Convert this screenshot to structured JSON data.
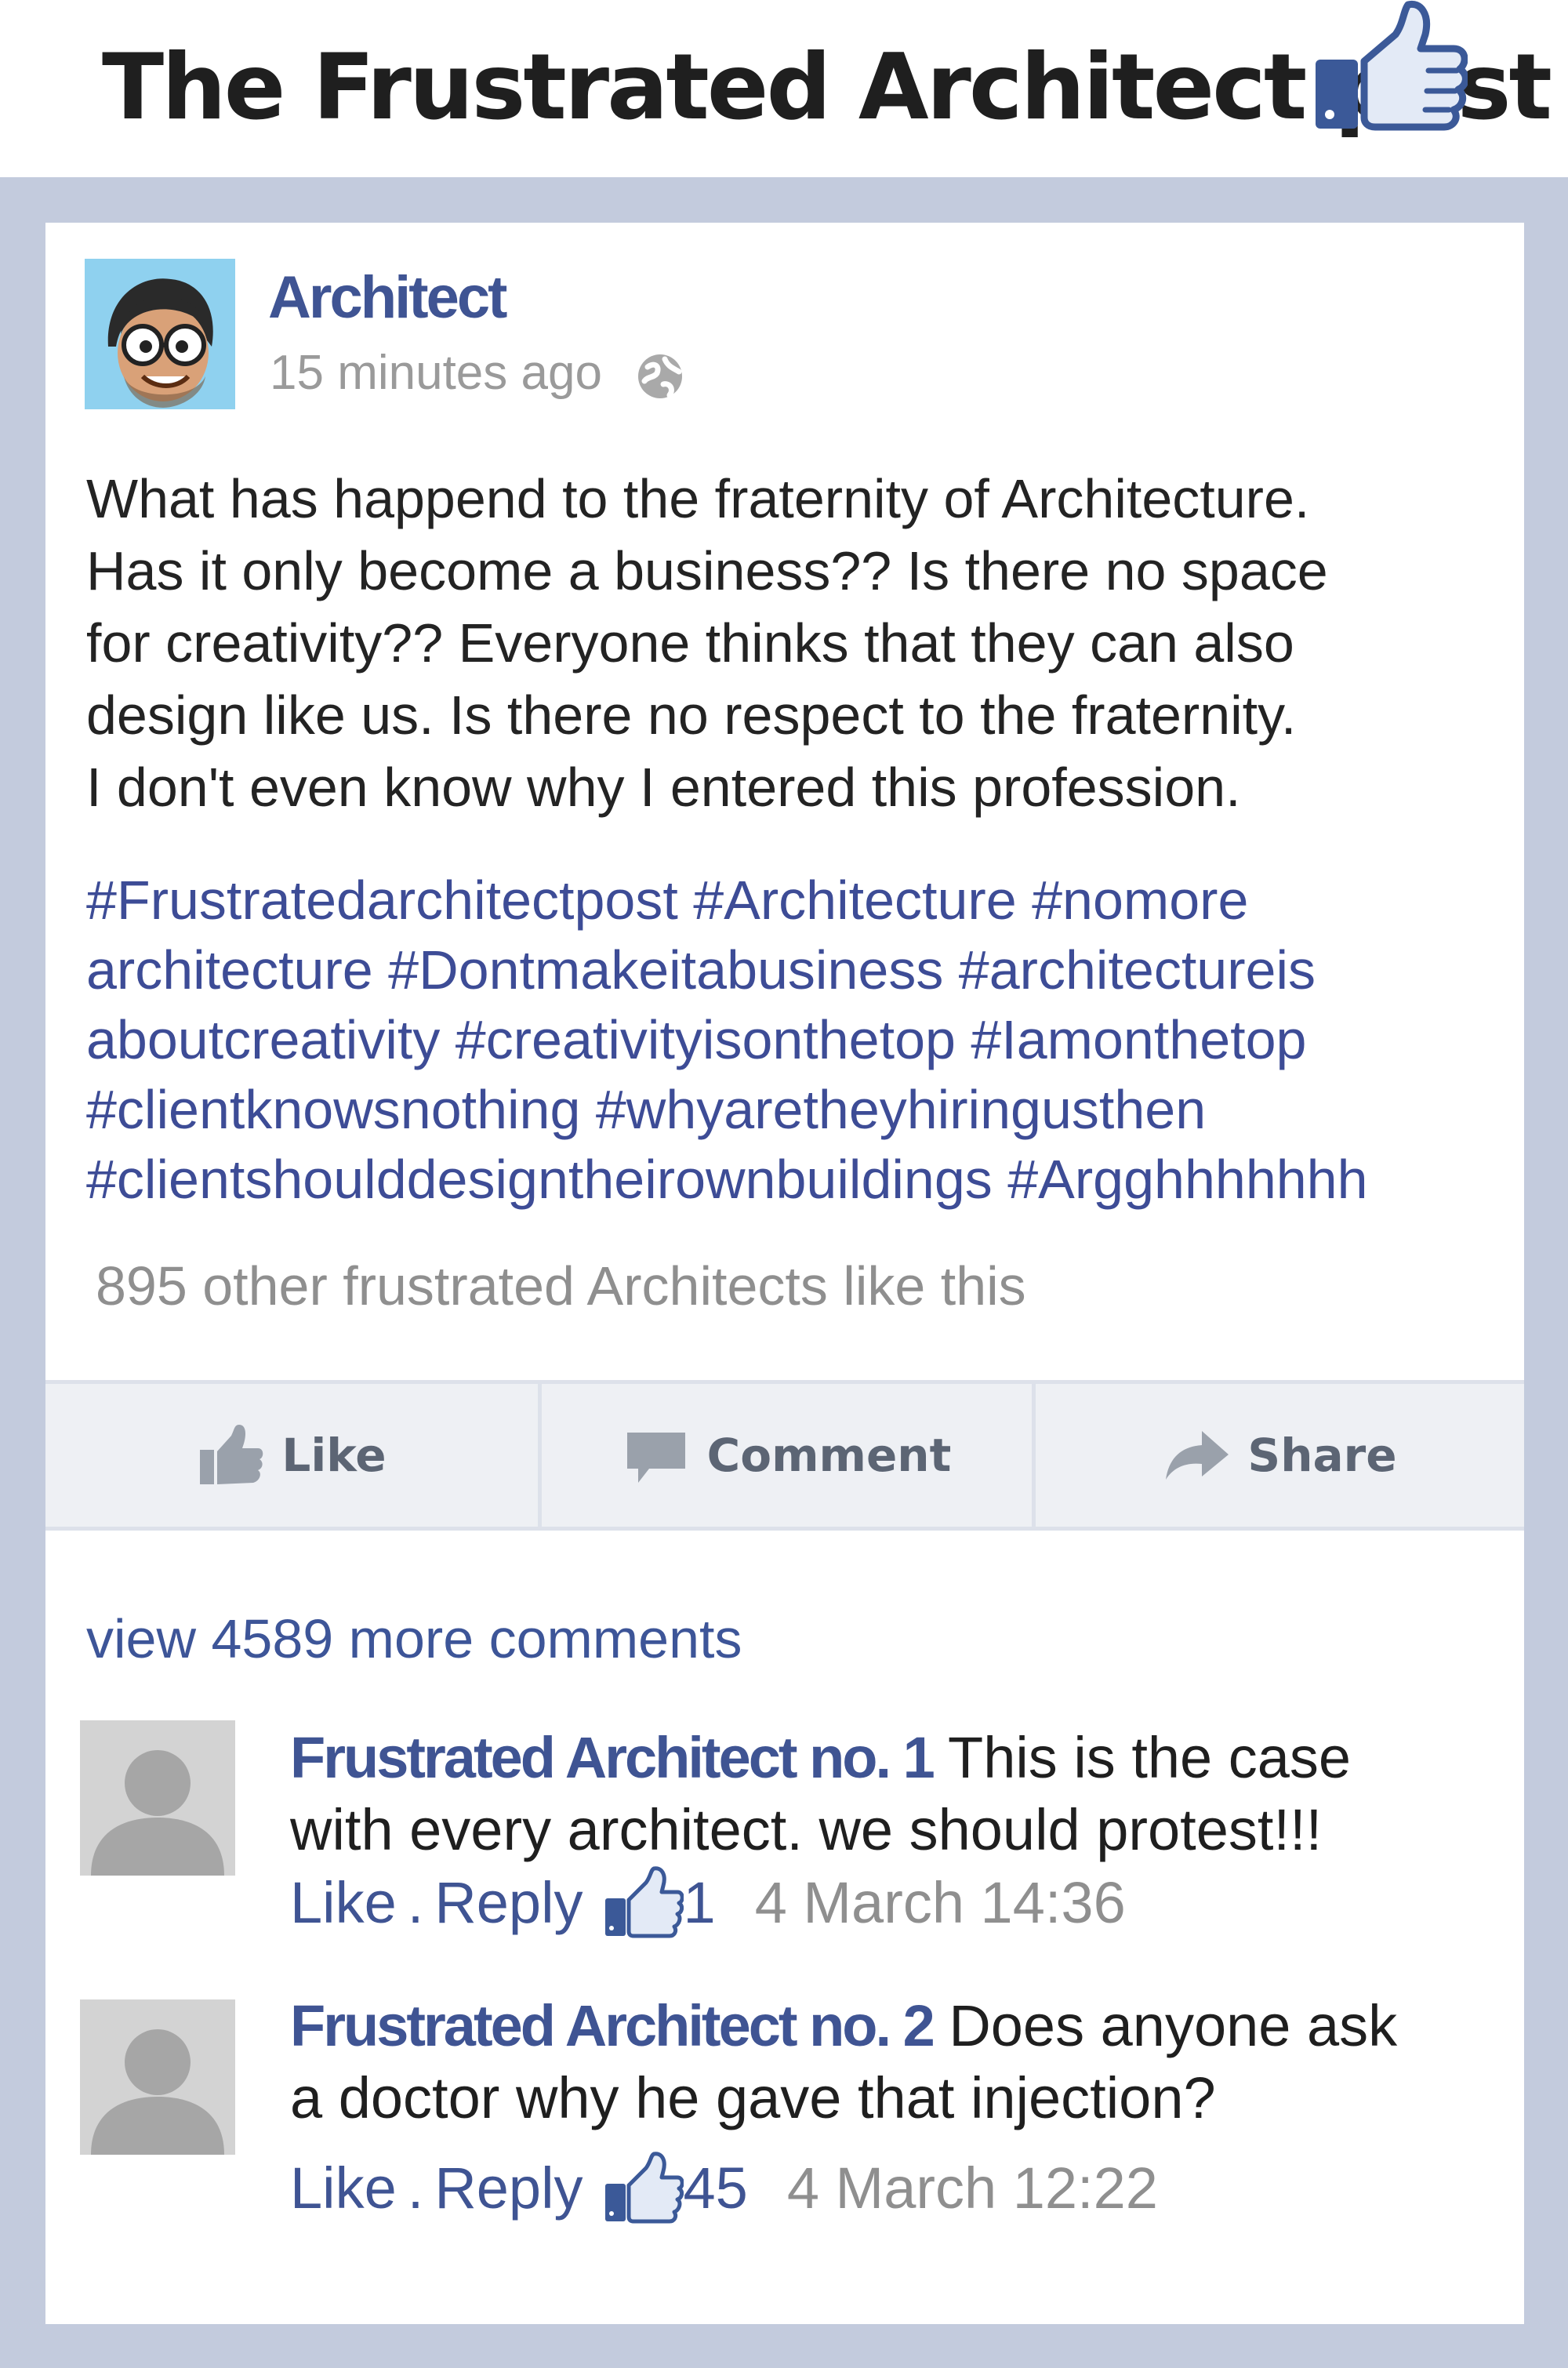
{
  "header": {
    "title": "The Frustrated Architect post",
    "icon": "thumbs-up-icon"
  },
  "post": {
    "author": "Architect",
    "time": "15 minutes ago",
    "privacy_icon": "globe-icon",
    "body_lines": [
      "What has happend to the fraternity of Architecture.",
      "Has it only become a business?? Is there no space",
      "for creativity?? Everyone thinks that they can also",
      "design like us. Is there no respect to the fraternity.",
      "I don't even know why I entered this profession."
    ],
    "hashtag_lines": [
      "#Frustratedarchitectpost #Architecture #nomore",
      "architecture #Dontmakeitabusiness #architectureis",
      "aboutcreativity #creativityisonthetop #Iamonthetop",
      "#clientknowsnothing #whyaretheyhiringusthen",
      "#clientshoulddesigntheirownbuildings #Argghhhhhhh"
    ],
    "likes_summary": "895 other frustrated Architects like this"
  },
  "actions": {
    "like": "Like",
    "comment": "Comment",
    "share": "Share"
  },
  "comments_section": {
    "view_more": "view 4589 more comments",
    "comments": [
      {
        "name": "Frustrated Architect no. 1",
        "text_first": " This is the case",
        "text_second": "with every architect. we should protest!!!",
        "like_label": "Like",
        "separator": ".",
        "reply_label": "Reply",
        "like_count": "1",
        "time": "4 March 14:36"
      },
      {
        "name": "Frustrated Architect no. 2",
        "text_first": " Does anyone ask",
        "text_second": " a doctor why he gave that injection?",
        "like_label": "Like",
        "separator": ".",
        "reply_label": "Reply",
        "like_count": "45",
        "time": "4 March 12:22"
      }
    ]
  },
  "colors": {
    "frame": "#c3cbdd",
    "link_blue": "#3f5493",
    "hashtag_blue": "#3d4c96",
    "muted_gray": "#8f8f8f",
    "action_bar": "#eef0f4"
  }
}
